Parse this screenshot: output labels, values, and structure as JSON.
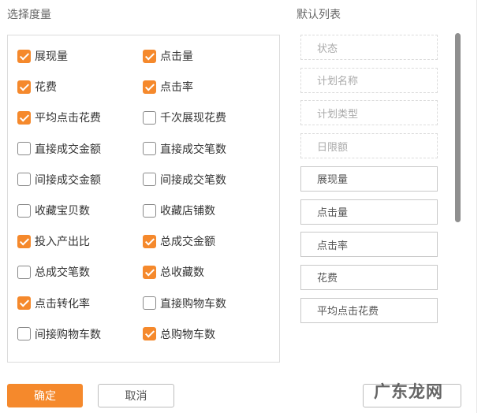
{
  "titles": {
    "select_metrics": "选择度量",
    "default_columns": "默认列表"
  },
  "metrics": [
    {
      "label": "展现量",
      "checked": true
    },
    {
      "label": "点击量",
      "checked": true
    },
    {
      "label": "花费",
      "checked": true
    },
    {
      "label": "点击率",
      "checked": true
    },
    {
      "label": "平均点击花费",
      "checked": true
    },
    {
      "label": "千次展现花费",
      "checked": false
    },
    {
      "label": "直接成交金额",
      "checked": false
    },
    {
      "label": "直接成交笔数",
      "checked": false
    },
    {
      "label": "间接成交金额",
      "checked": false
    },
    {
      "label": "间接成交笔数",
      "checked": false
    },
    {
      "label": "收藏宝贝数",
      "checked": false
    },
    {
      "label": "收藏店铺数",
      "checked": false
    },
    {
      "label": "投入产出比",
      "checked": true
    },
    {
      "label": "总成交金额",
      "checked": true
    },
    {
      "label": "总成交笔数",
      "checked": false
    },
    {
      "label": "总收藏数",
      "checked": true
    },
    {
      "label": "点击转化率",
      "checked": true
    },
    {
      "label": "直接购物车数",
      "checked": false
    },
    {
      "label": "间接购物车数",
      "checked": false
    },
    {
      "label": "总购物车数",
      "checked": true
    }
  ],
  "columns": [
    {
      "label": "状态",
      "fixed": true
    },
    {
      "label": "计划名称",
      "fixed": true
    },
    {
      "label": "计划类型",
      "fixed": true
    },
    {
      "label": "日限额",
      "fixed": true
    },
    {
      "label": "展现量",
      "fixed": false
    },
    {
      "label": "点击量",
      "fixed": false
    },
    {
      "label": "点击率",
      "fixed": false
    },
    {
      "label": "花费",
      "fixed": false
    },
    {
      "label": "平均点击花费",
      "fixed": false
    }
  ],
  "buttons": {
    "ok": "确定",
    "cancel": "取消"
  },
  "watermark": "广东龙网"
}
